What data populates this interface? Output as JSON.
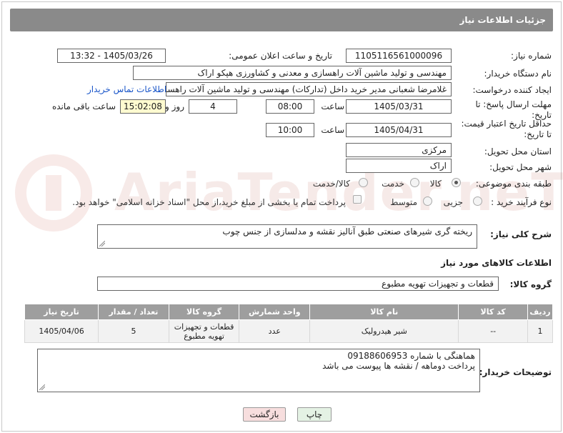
{
  "header": {
    "title": "جزئیات اطلاعات نیاز"
  },
  "need_number": {
    "label": "شماره نیاز:",
    "value": "1105116561000096"
  },
  "announce": {
    "label": "تاریخ و ساعت اعلان عمومی:",
    "value": "1405/03/26 - 13:32"
  },
  "buyer": {
    "label": "نام دستگاه خریدار:",
    "value": "مهندسی و تولید ماشین آلات راهسازی و معدنی و کشاورزی هپکو اراک"
  },
  "requester": {
    "label": "ایجاد کننده درخواست:",
    "value": "غلامرضا شعبانی مدیر خرید داخل (تدارکات) مهندسی و تولید ماشین آلات راهسا",
    "contact_link": "اطلاعات تماس خریدار"
  },
  "deadline": {
    "label_line1": "مهلت ارسال پاسخ: تا",
    "label_line2": "تاریخ:",
    "date": "1405/03/31",
    "time_label": "ساعت",
    "time": "08:00",
    "days": "4",
    "days_label": "روز و",
    "remaining": "15:02:08",
    "remaining_label": "ساعت باقی مانده"
  },
  "price_validity": {
    "label_line1": "حداقل تاریخ اعتبار قیمت:",
    "label_line2": "تا تاریخ:",
    "date": "1405/04/31",
    "time_label": "ساعت",
    "time": "10:00"
  },
  "province": {
    "label": "استان محل تحویل:",
    "value": "مرکزی"
  },
  "city": {
    "label": "شهر محل تحویل:",
    "value": "اراک"
  },
  "category": {
    "label": "طبقه بندی موضوعی:",
    "options": [
      "کالا",
      "خدمت",
      "کالا/خدمت"
    ],
    "selected": "کالا"
  },
  "process": {
    "label": "نوع فرآیند خرید :",
    "options": [
      "جزیی",
      "متوسط"
    ],
    "payment_note": "پرداخت تمام یا بخشی از مبلغ خرید،از محل \"اسناد خزانه اسلامی\" خواهد بود."
  },
  "description": {
    "label": "شرح کلی نیاز:",
    "value": "ریخته گری شیرهای صنعتی طبق آنالیز نقشه و مدلسازی از جنس چوب"
  },
  "items_section": {
    "title": "اطلاعات کالاهای مورد نیاز"
  },
  "goods_group": {
    "label": "گروه کالا:",
    "value": "قطعات و تجهیزات تهویه مطبوع"
  },
  "table": {
    "headers": [
      "ردیف",
      "کد کالا",
      "نام کالا",
      "واحد شمارش",
      "گروه کالا",
      "تعداد / مقدار",
      "تاریخ نیاز"
    ],
    "rows": [
      [
        "1",
        "--",
        "شیر هیدرولیک",
        "عدد",
        "قطعات و تجهیزات تهویه مطبوع",
        "5",
        "1405/04/06"
      ]
    ]
  },
  "buyer_notes": {
    "label": "توضیحات خریدار:",
    "line1": "هماهنگی با شماره 09188606953",
    "line2": "پرداخت دوماهه / نقشه ها پیوست می باشد"
  },
  "buttons": {
    "print": "چاپ",
    "back": "بازگشت"
  },
  "watermark": {
    "text": "AriaTender.neT"
  },
  "colors": {
    "header_bg": "#8a8a8a",
    "link": "#1a56c9",
    "remaining_bg": "#fffbd0",
    "back_btn_bg": "#f7dede",
    "print_btn_bg": "#e4f2e4"
  }
}
